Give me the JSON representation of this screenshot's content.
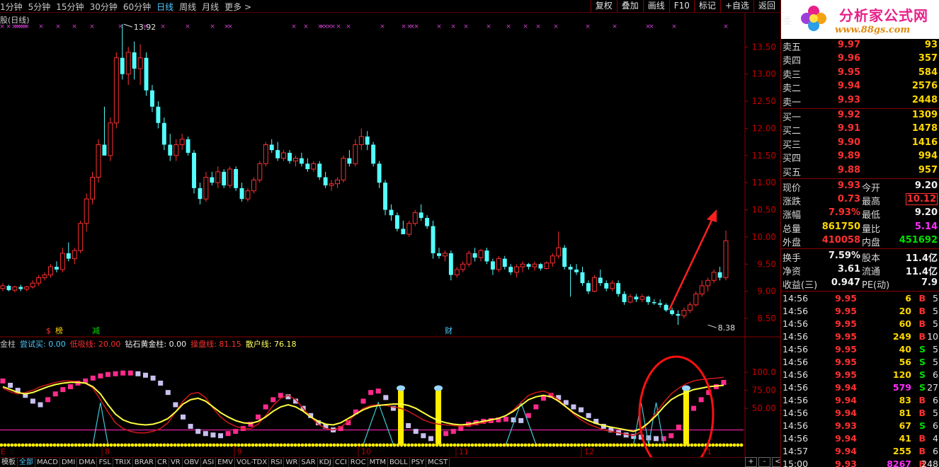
{
  "periods": [
    "1分钟",
    "5分钟",
    "15分钟",
    "30分钟",
    "60分钟",
    "日线",
    "周线",
    "月线",
    "更多 >"
  ],
  "active_period": "日线",
  "toolbar": [
    "复权",
    "叠加",
    "画线",
    "F10",
    "标记",
    "+自选",
    "返回"
  ],
  "main_title": "股(日线)",
  "price_labels": [
    "13.50",
    "13.00",
    "12.50",
    "12.00",
    "11.50",
    "11.00",
    "10.50",
    "10.00",
    "9.50",
    "9.00",
    "8.50"
  ],
  "annotations": {
    "high": "13.92",
    "low": "8.38",
    "badge_1": "榜",
    "badge_2": "减",
    "badge_3": "财"
  },
  "sub_legend": [
    {
      "text": "金柱",
      "color": "#c0c0c0"
    },
    {
      "text": "尝试买: 0.00",
      "color": "#4ec9ff"
    },
    {
      "text": "低吸线: 20.00",
      "color": "#ff3030"
    },
    {
      "text": "钻石黄金柱: 0.00",
      "color": "#f0f0f0"
    },
    {
      "text": "操盘线: 81.15",
      "color": "#ff3030"
    },
    {
      "text": "散户线: 76.18",
      "color": "#ffff60"
    }
  ],
  "sub_labels": [
    "100.0",
    "75.00",
    "50.00"
  ],
  "x_labels": [
    "8",
    "9",
    "10",
    "11",
    "12",
    "1"
  ],
  "left_tag": "E",
  "tabs": [
    "模板",
    "全部",
    "MACD",
    "DMI",
    "DMA",
    "FSL",
    "TRIX",
    "BRAR",
    "CR",
    "VR",
    "OBV",
    "ASI",
    "EMV",
    "VOL-TDX",
    "RSI",
    "WR",
    "SAR",
    "KDJ",
    "CCI",
    "ROC",
    "MTM",
    "BOLL",
    "PSY",
    "MCST"
  ],
  "active_tab": "全部",
  "scroll_buttons": [
    "+",
    "-",
    "<"
  ],
  "logo": {
    "title": "分析家公式网",
    "url": "www.88gs.com"
  },
  "orderbook": {
    "header_label": "委",
    "sell": [
      {
        "label": "卖五",
        "price": "9.97",
        "vol": "93"
      },
      {
        "label": "卖四",
        "price": "9.96",
        "vol": "357"
      },
      {
        "label": "卖三",
        "price": "9.95",
        "vol": "584"
      },
      {
        "label": "卖二",
        "price": "9.94",
        "vol": "2576"
      },
      {
        "label": "卖一",
        "price": "9.93",
        "vol": "2448"
      }
    ],
    "buy": [
      {
        "label": "买一",
        "price": "9.92",
        "vol": "1309"
      },
      {
        "label": "买二",
        "price": "9.91",
        "vol": "1478"
      },
      {
        "label": "买三",
        "price": "9.90",
        "vol": "1416"
      },
      {
        "label": "买四",
        "price": "9.89",
        "vol": "994"
      },
      {
        "label": "买五",
        "price": "9.88",
        "vol": "957"
      }
    ]
  },
  "quote": [
    {
      "l1": "现价",
      "v1": "9.93",
      "l2": "今开",
      "v2": "9.20"
    },
    {
      "l1": "涨跌",
      "v1": "0.73",
      "l2": "最高",
      "v2": "10.12"
    },
    {
      "l1": "涨幅",
      "v1": "7.93%",
      "l2": "最低",
      "v2": "9.20"
    },
    {
      "l1": "总量",
      "v1": "861750",
      "l2": "量比",
      "v2": "5.14"
    },
    {
      "l1": "外盘",
      "v1": "410058",
      "l2": "内盘",
      "v2": "451692"
    }
  ],
  "fundamentals": [
    {
      "l1": "换手",
      "v1": "7.59%",
      "l2": "股本",
      "v2": "11.4亿"
    },
    {
      "l1": "净资",
      "v1": "3.61",
      "l2": "流通",
      "v2": "11.4亿"
    },
    {
      "l1": "收益(三)",
      "v1": "0.947",
      "l2": "PE(动)",
      "v2": "7.9"
    }
  ],
  "ticks": [
    {
      "t": "14:56",
      "p": "9.95",
      "v": "6",
      "bs": "B",
      "n": "5"
    },
    {
      "t": "14:56",
      "p": "9.95",
      "v": "20",
      "bs": "B",
      "n": "5"
    },
    {
      "t": "14:56",
      "p": "9.95",
      "v": "60",
      "bs": "B",
      "n": "5"
    },
    {
      "t": "14:56",
      "p": "9.95",
      "v": "249",
      "bs": "B",
      "n": "10"
    },
    {
      "t": "14:56",
      "p": "9.95",
      "v": "40",
      "bs": "S",
      "n": "5"
    },
    {
      "t": "14:56",
      "p": "9.95",
      "v": "56",
      "bs": "S",
      "n": "5"
    },
    {
      "t": "14:56",
      "p": "9.95",
      "v": "120",
      "bs": "S",
      "n": "6"
    },
    {
      "t": "14:56",
      "p": "9.94",
      "v": "579",
      "bs": "S",
      "n": "27"
    },
    {
      "t": "14:56",
      "p": "9.94",
      "v": "83",
      "bs": "B",
      "n": "6"
    },
    {
      "t": "14:56",
      "p": "9.94",
      "v": "81",
      "bs": "B",
      "n": "5"
    },
    {
      "t": "14:56",
      "p": "9.93",
      "v": "67",
      "bs": "S",
      "n": "6"
    },
    {
      "t": "14:56",
      "p": "9.94",
      "v": "41",
      "bs": "B",
      "n": "4"
    },
    {
      "t": "14:57",
      "p": "9.94",
      "v": "255",
      "bs": "B",
      "n": "6"
    },
    {
      "t": "15:00",
      "p": "9.93",
      "v": "8267",
      "bs": "B",
      "n": "248"
    }
  ],
  "candles": [
    [
      9.05,
      9.15,
      9.0,
      9.1
    ],
    [
      9.1,
      9.12,
      9.0,
      9.02
    ],
    [
      9.02,
      9.1,
      8.98,
      9.08
    ],
    [
      9.08,
      9.12,
      9.0,
      9.04
    ],
    [
      9.04,
      9.1,
      9.0,
      9.08
    ],
    [
      9.08,
      9.2,
      9.05,
      9.15
    ],
    [
      9.15,
      9.3,
      9.1,
      9.25
    ],
    [
      9.25,
      9.35,
      9.2,
      9.3
    ],
    [
      9.3,
      9.5,
      9.25,
      9.45
    ],
    [
      9.45,
      9.55,
      9.35,
      9.4
    ],
    [
      9.4,
      9.8,
      9.35,
      9.7
    ],
    [
      9.7,
      9.9,
      9.55,
      9.6
    ],
    [
      9.6,
      9.8,
      9.5,
      9.75
    ],
    [
      9.75,
      10.3,
      9.7,
      10.25
    ],
    [
      10.25,
      10.8,
      10.1,
      10.7
    ],
    [
      10.7,
      11.2,
      10.6,
      11.1
    ],
    [
      11.1,
      11.8,
      11.0,
      11.7
    ],
    [
      11.7,
      12.4,
      11.6,
      11.5
    ],
    [
      11.5,
      12.2,
      11.4,
      12.1
    ],
    [
      12.1,
      13.4,
      12.0,
      13.3
    ],
    [
      13.3,
      13.92,
      12.9,
      13.0
    ],
    [
      13.0,
      13.5,
      12.8,
      13.4
    ],
    [
      13.4,
      13.6,
      12.9,
      13.1
    ],
    [
      13.1,
      13.55,
      12.8,
      13.3
    ],
    [
      13.3,
      13.4,
      12.6,
      12.7
    ],
    [
      12.7,
      12.8,
      12.3,
      12.4
    ],
    [
      12.4,
      12.5,
      12.0,
      12.1
    ],
    [
      12.1,
      12.2,
      11.6,
      11.7
    ],
    [
      11.7,
      11.9,
      11.4,
      11.5
    ],
    [
      11.5,
      11.8,
      11.4,
      11.7
    ],
    [
      11.7,
      11.9,
      11.6,
      11.8
    ],
    [
      11.8,
      11.85,
      11.5,
      11.55
    ],
    [
      11.55,
      11.6,
      10.8,
      10.9
    ],
    [
      10.9,
      11.0,
      10.6,
      10.7
    ],
    [
      10.7,
      11.2,
      10.65,
      11.1
    ],
    [
      11.1,
      11.2,
      10.95,
      11.0
    ],
    [
      11.0,
      11.3,
      10.9,
      11.2
    ],
    [
      11.2,
      11.25,
      10.9,
      10.95
    ],
    [
      10.95,
      11.3,
      10.9,
      11.25
    ],
    [
      11.25,
      11.3,
      10.85,
      10.9
    ],
    [
      10.9,
      11.0,
      10.65,
      10.7
    ],
    [
      10.7,
      10.9,
      10.65,
      10.85
    ],
    [
      10.85,
      11.1,
      10.8,
      11.05
    ],
    [
      11.05,
      11.4,
      11.0,
      11.35
    ],
    [
      11.35,
      11.75,
      11.3,
      11.7
    ],
    [
      11.7,
      11.8,
      11.55,
      11.6
    ],
    [
      11.6,
      11.75,
      11.4,
      11.45
    ],
    [
      11.45,
      11.6,
      11.4,
      11.55
    ],
    [
      11.55,
      11.6,
      11.35,
      11.4
    ],
    [
      11.4,
      11.5,
      11.3,
      11.45
    ],
    [
      11.45,
      11.55,
      11.3,
      11.35
    ],
    [
      11.35,
      11.45,
      11.2,
      11.25
    ],
    [
      11.25,
      11.4,
      11.2,
      11.35
    ],
    [
      11.35,
      11.4,
      11.05,
      11.1
    ],
    [
      11.1,
      11.2,
      10.9,
      10.95
    ],
    [
      10.95,
      11.05,
      10.85,
      10.98
    ],
    [
      10.98,
      11.1,
      10.9,
      11.05
    ],
    [
      11.05,
      11.5,
      11.0,
      11.45
    ],
    [
      11.45,
      11.6,
      11.3,
      11.35
    ],
    [
      11.35,
      11.8,
      11.3,
      11.7
    ],
    [
      11.7,
      12.0,
      11.6,
      11.85
    ],
    [
      11.85,
      11.95,
      11.6,
      11.7
    ],
    [
      11.7,
      11.75,
      11.3,
      11.35
    ],
    [
      11.35,
      11.4,
      10.9,
      11.0
    ],
    [
      11.0,
      11.05,
      10.4,
      10.5
    ],
    [
      10.5,
      10.6,
      10.3,
      10.4
    ],
    [
      10.4,
      10.45,
      10.1,
      10.15
    ],
    [
      10.15,
      10.3,
      10.05,
      10.05
    ],
    [
      10.05,
      10.3,
      10.0,
      10.25
    ],
    [
      10.25,
      10.5,
      10.2,
      10.45
    ],
    [
      10.45,
      10.6,
      10.3,
      10.35
    ],
    [
      10.35,
      10.4,
      10.15,
      10.2
    ],
    [
      10.2,
      10.3,
      9.6,
      9.7
    ],
    [
      9.7,
      9.8,
      9.6,
      9.65
    ],
    [
      9.65,
      9.75,
      9.55,
      9.7
    ],
    [
      9.7,
      9.75,
      9.2,
      9.3
    ],
    [
      9.3,
      9.45,
      9.25,
      9.4
    ],
    [
      9.4,
      9.55,
      9.35,
      9.5
    ],
    [
      9.5,
      9.75,
      9.45,
      9.7
    ],
    [
      9.7,
      9.8,
      9.55,
      9.62
    ],
    [
      9.62,
      9.78,
      9.55,
      9.75
    ],
    [
      9.75,
      9.8,
      9.5,
      9.55
    ],
    [
      9.55,
      9.6,
      9.3,
      9.4
    ],
    [
      9.4,
      9.65,
      9.35,
      9.6
    ],
    [
      9.6,
      9.65,
      9.4,
      9.45
    ],
    [
      9.45,
      9.5,
      9.3,
      9.35
    ],
    [
      9.35,
      9.5,
      9.25,
      9.45
    ],
    [
      9.45,
      9.55,
      9.35,
      9.5
    ],
    [
      9.5,
      9.52,
      9.4,
      9.45
    ],
    [
      9.45,
      9.55,
      9.38,
      9.5
    ],
    [
      9.5,
      9.52,
      9.38,
      9.42
    ],
    [
      9.42,
      9.55,
      9.4,
      9.52
    ],
    [
      9.52,
      9.7,
      9.45,
      9.65
    ],
    [
      9.65,
      10.1,
      9.6,
      9.8
    ],
    [
      9.8,
      9.85,
      9.4,
      9.45
    ],
    [
      9.45,
      9.5,
      8.9,
      9.4
    ],
    [
      9.4,
      9.5,
      9.3,
      9.35
    ],
    [
      9.35,
      9.45,
      9.1,
      9.15
    ],
    [
      9.15,
      9.2,
      8.95,
      9.0
    ],
    [
      9.0,
      9.3,
      8.98,
      9.25
    ],
    [
      9.25,
      9.4,
      9.1,
      9.15
    ],
    [
      9.15,
      9.2,
      9.0,
      9.05
    ],
    [
      9.05,
      9.2,
      9.0,
      9.15
    ],
    [
      9.15,
      9.2,
      8.9,
      8.95
    ],
    [
      8.95,
      9.0,
      8.75,
      8.8
    ],
    [
      8.8,
      8.95,
      8.78,
      8.9
    ],
    [
      8.9,
      8.95,
      8.8,
      8.85
    ],
    [
      8.85,
      8.95,
      8.8,
      8.9
    ],
    [
      8.9,
      8.92,
      8.75,
      8.8
    ],
    [
      8.8,
      8.85,
      8.75,
      8.78
    ],
    [
      8.78,
      8.85,
      8.7,
      8.75
    ],
    [
      8.75,
      8.78,
      8.62,
      8.65
    ],
    [
      8.65,
      8.7,
      8.55,
      8.58
    ],
    [
      8.58,
      8.65,
      8.38,
      8.55
    ],
    [
      8.55,
      8.7,
      8.5,
      8.65
    ],
    [
      8.65,
      8.8,
      8.6,
      8.75
    ],
    [
      8.75,
      9.0,
      8.72,
      8.95
    ],
    [
      8.95,
      9.2,
      8.9,
      9.1
    ],
    [
      9.1,
      9.25,
      9.0,
      9.2
    ],
    [
      9.2,
      9.4,
      9.15,
      9.35
    ],
    [
      9.35,
      9.45,
      9.2,
      9.25
    ],
    [
      9.25,
      10.12,
      9.2,
      9.93
    ]
  ],
  "oscillator": {
    "bars": [
      88,
      82,
      75,
      68,
      60,
      55,
      62,
      70,
      76,
      80,
      85,
      88,
      92,
      95,
      97,
      98,
      99,
      99,
      98,
      96,
      92,
      85,
      72,
      55,
      38,
      25,
      18,
      15,
      13,
      12,
      15,
      18,
      22,
      28,
      38,
      52,
      62,
      68,
      66,
      60,
      50,
      40,
      30,
      25,
      20,
      22,
      30,
      45,
      60,
      72,
      74,
      65,
      50,
      38,
      26,
      18,
      12,
      8,
      10,
      15,
      18,
      22,
      28,
      30,
      32,
      33,
      34,
      35,
      34,
      33,
      40,
      52,
      64,
      68,
      65,
      58,
      52,
      48,
      40,
      32,
      25,
      20,
      16,
      13,
      11,
      10,
      9,
      8,
      8,
      12,
      24,
      38,
      50,
      62,
      72,
      80,
      86
    ],
    "yellow": [
      80,
      76,
      72,
      70,
      72,
      76,
      80,
      83,
      85,
      86,
      86,
      85,
      80,
      70,
      55,
      42,
      34,
      30,
      28,
      27,
      28,
      31,
      36,
      45,
      56,
      62,
      64,
      60,
      52,
      44,
      38,
      33,
      30,
      29,
      32,
      38,
      46,
      52,
      55,
      52,
      46,
      38,
      32,
      28,
      27,
      30,
      36,
      42,
      48,
      52,
      54,
      55,
      56,
      56,
      54,
      50,
      44,
      38,
      33,
      30,
      28,
      27,
      28,
      30,
      32,
      34,
      36,
      40,
      46,
      54,
      62,
      66,
      68,
      66,
      60,
      52,
      44,
      38,
      33,
      29,
      26,
      24,
      22,
      20,
      18,
      22,
      30,
      40,
      52,
      62,
      68,
      72,
      76,
      78,
      80,
      81,
      82
    ],
    "red": [
      78,
      73,
      70,
      72,
      75,
      80,
      83,
      86,
      88,
      88,
      87,
      85,
      78,
      62,
      45,
      30,
      22,
      18,
      16,
      16,
      18,
      22,
      30,
      45,
      60,
      70,
      72,
      65,
      50,
      38,
      30,
      25,
      22,
      22,
      28,
      40,
      54,
      64,
      68,
      62,
      50,
      38,
      28,
      22,
      20,
      24,
      32,
      42,
      50,
      54,
      55,
      54,
      52,
      50,
      46,
      40,
      34,
      30,
      28,
      27,
      26,
      25,
      26,
      28,
      30,
      33,
      36,
      40,
      48,
      58,
      68,
      72,
      74,
      70,
      62,
      52,
      42,
      34,
      28,
      24,
      20,
      18,
      16,
      14,
      12,
      18,
      30,
      44,
      58,
      70,
      78,
      84,
      88,
      90,
      91,
      92,
      93
    ],
    "cyan_spikes": [
      [
        2,
        2,
        14,
        0
      ],
      [
        50,
        5,
        45,
        0
      ],
      [
        69,
        10,
        63,
        0
      ],
      [
        85,
        11,
        55,
        0
      ],
      [
        87,
        11.8,
        54,
        0
      ]
    ],
    "yellow_bars": [
      53,
      58,
      91
    ],
    "threshold": 20
  },
  "arrow_note": "up-arrow"
}
